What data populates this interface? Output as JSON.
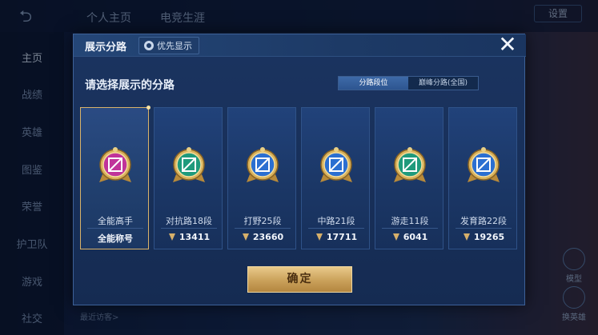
{
  "background": {
    "tabs": [
      "个人主页",
      "电竞生涯"
    ],
    "settings_label": "设置",
    "sidebar_items": [
      "主页",
      "战绩",
      "英雄",
      "图鉴",
      "荣誉",
      "护卫队",
      "游戏",
      "社交"
    ],
    "recent_visitors": "最近访客>",
    "change_hero": "换英雄",
    "model_label": "模型"
  },
  "modal": {
    "title": "展示分路",
    "priority_label": "优先显示",
    "close_symbol": "✕",
    "subtitle": "请选择展示的分路",
    "toggle": [
      "分路段位",
      "巅峰分路(全国)"
    ],
    "toggle_active_index": 0,
    "confirm_label": "确定",
    "cards": [
      {
        "label": "全能高手",
        "value": "全能称号",
        "icon": "all-round-icon",
        "selected": true,
        "show_points_icon": false,
        "color": "#c0339a"
      },
      {
        "label": "对抗路18段",
        "value": "13411",
        "icon": "clash-lane-icon",
        "selected": false,
        "show_points_icon": true,
        "color": "#1f9a7c"
      },
      {
        "label": "打野25段",
        "value": "23660",
        "icon": "jungle-icon",
        "selected": false,
        "show_points_icon": true,
        "color": "#2b6fd1"
      },
      {
        "label": "中路21段",
        "value": "17711",
        "icon": "mid-lane-icon",
        "selected": false,
        "show_points_icon": true,
        "color": "#2b6fd1"
      },
      {
        "label": "游走11段",
        "value": "6041",
        "icon": "roam-icon",
        "selected": false,
        "show_points_icon": true,
        "color": "#1f9a7c"
      },
      {
        "label": "发育路22段",
        "value": "19265",
        "icon": "farm-lane-icon",
        "selected": false,
        "show_points_icon": true,
        "color": "#2b6fd1"
      }
    ]
  }
}
